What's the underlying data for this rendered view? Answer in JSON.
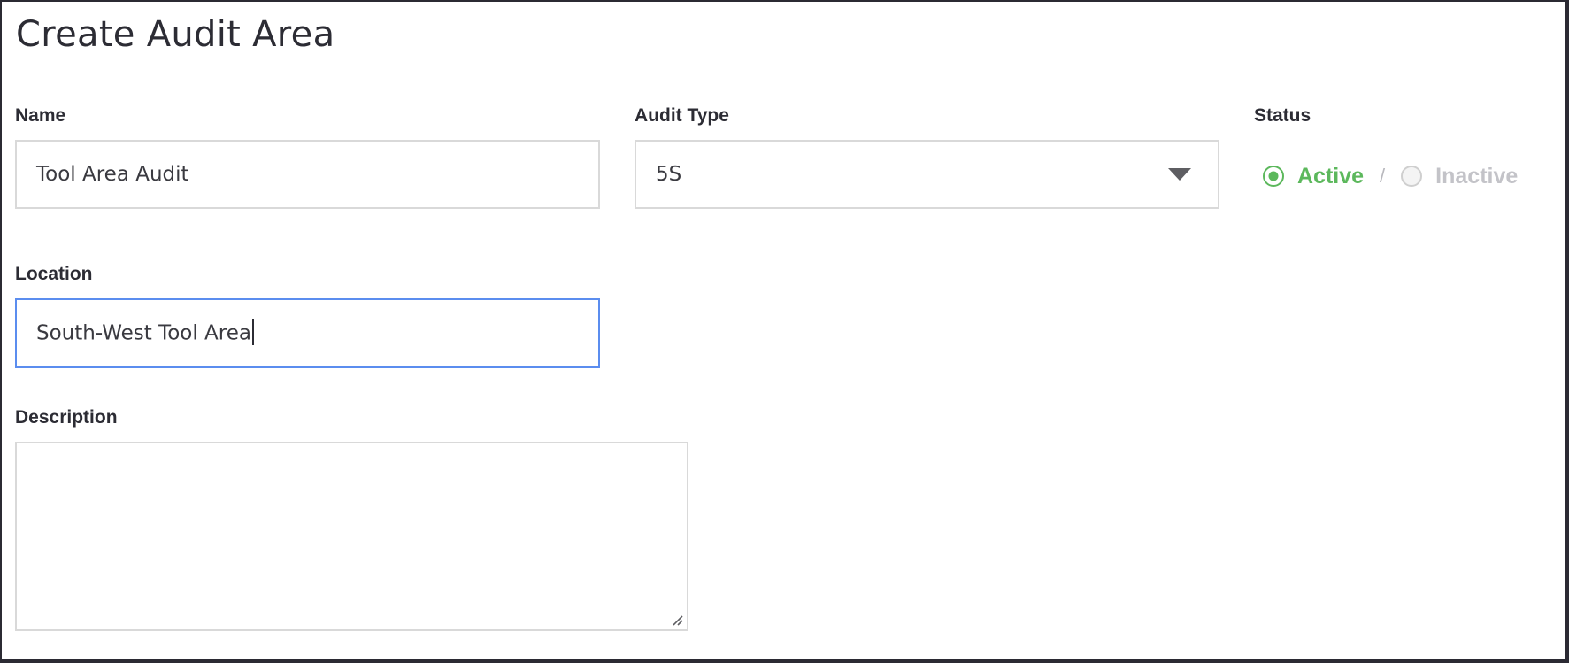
{
  "page": {
    "title": "Create Audit Area"
  },
  "form": {
    "name": {
      "label": "Name",
      "value": "Tool Area Audit"
    },
    "audit_type": {
      "label": "Audit Type",
      "selected": "5S",
      "icon": "chevron-down-icon"
    },
    "status": {
      "label": "Status",
      "options": [
        {
          "label": "Active",
          "selected": true
        },
        {
          "label": "Inactive",
          "selected": false
        }
      ],
      "separator": "/",
      "active_color": "#5cb85c",
      "inactive_color": "#c3c3c8"
    },
    "location": {
      "label": "Location",
      "value": "South-West Tool Area",
      "focused": true,
      "focus_color": "#5b8def"
    },
    "description": {
      "label": "Description",
      "value": ""
    }
  }
}
